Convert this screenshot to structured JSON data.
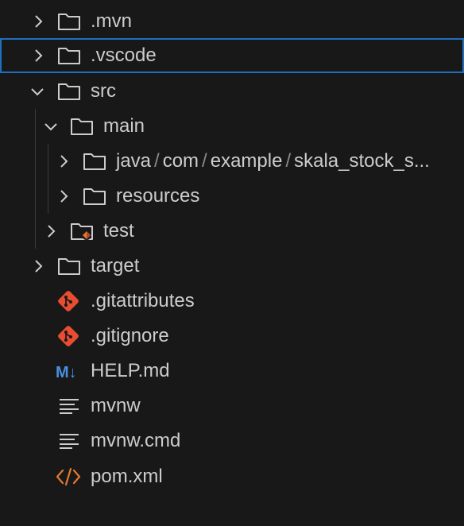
{
  "tree": {
    "mvn": ".mvn",
    "vscode": ".vscode",
    "src": "src",
    "main": "main",
    "java_path": [
      "java",
      "com",
      "example",
      "skala_stock_s..."
    ],
    "resources": "resources",
    "test": "test",
    "target": "target",
    "gitattributes": ".gitattributes",
    "gitignore": ".gitignore",
    "help_md": "HELP.md",
    "mvnw": "mvnw",
    "mvnw_cmd": "mvnw.cmd",
    "pom_xml": "pom.xml"
  },
  "icons": {
    "md_glyph": "M↓"
  },
  "colors": {
    "background": "#181818",
    "selection_border": "#1f6fbf",
    "git_icon": "#e84d31",
    "xml_icon": "#e37933",
    "markdown_icon": "#4a90e2",
    "text": "#cccccc"
  }
}
